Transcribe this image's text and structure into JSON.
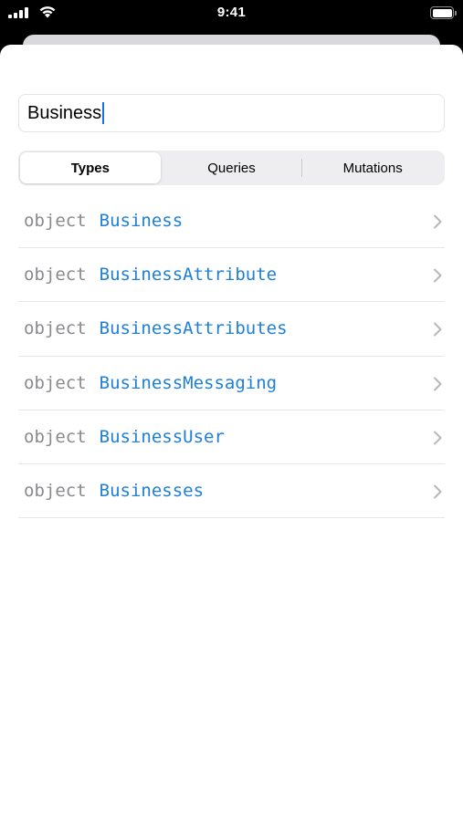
{
  "status_bar": {
    "time": "9:41",
    "icons": [
      "cellular-signal-icon",
      "wifi-icon",
      "battery-icon"
    ]
  },
  "search": {
    "value": "Business"
  },
  "tabs": [
    {
      "label": "Types",
      "selected": true
    },
    {
      "label": "Queries",
      "selected": false
    },
    {
      "label": "Mutations",
      "selected": false
    }
  ],
  "results": [
    {
      "kind": "object",
      "name": "Business"
    },
    {
      "kind": "object",
      "name": "BusinessAttribute"
    },
    {
      "kind": "object",
      "name": "BusinessAttributes"
    },
    {
      "kind": "object",
      "name": "BusinessMessaging"
    },
    {
      "kind": "object",
      "name": "BusinessUser"
    },
    {
      "kind": "object",
      "name": "Businesses"
    }
  ],
  "colors": {
    "type_name": "#1e7fd8",
    "kind_label": "#8a8a8e",
    "caret": "#1a73e8"
  }
}
